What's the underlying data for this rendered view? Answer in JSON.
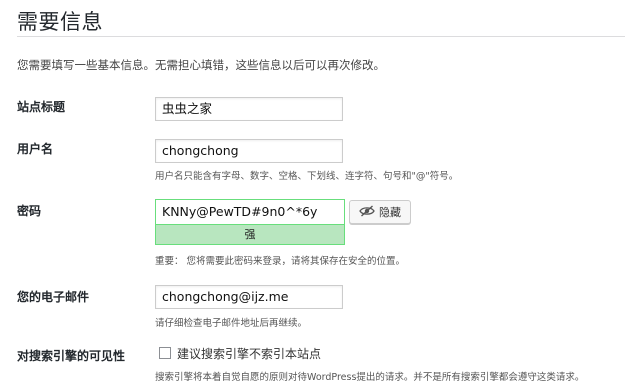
{
  "page": {
    "title": "需要信息",
    "intro": "您需要填写一些基本信息。无需担心填错，这些信息以后可以再次修改。"
  },
  "site_title": {
    "label": "站点标题",
    "value": "虫虫之家"
  },
  "username": {
    "label": "用户名",
    "value": "chongchong",
    "hint": "用户名只能含有字母、数字、空格、下划线、连字符、句号和\"@\"符号。"
  },
  "password": {
    "label": "密码",
    "value": "KNNy@PewTD#9n0^*6y",
    "strength": "强",
    "hide_label": "隐藏",
    "hide_icon": "eye-slash-icon",
    "hint": "重要：  您将需要此密码来登录，请将其保存在安全的位置。",
    "strength_color": "#b8e6bf"
  },
  "email": {
    "label": "您的电子邮件",
    "value": "chongchong@ijz.me",
    "hint": "请仔细检查电子邮件地址后再继续。"
  },
  "search_visibility": {
    "label": "对搜索引擎的可见性",
    "checkbox_label": "建议搜索引擎不索引本站点",
    "checked": false,
    "hint": "搜索引擎将本着自觉自愿的原则对待WordPress提出的请求。并不是所有搜索引擎都会遵守这类请求。"
  }
}
